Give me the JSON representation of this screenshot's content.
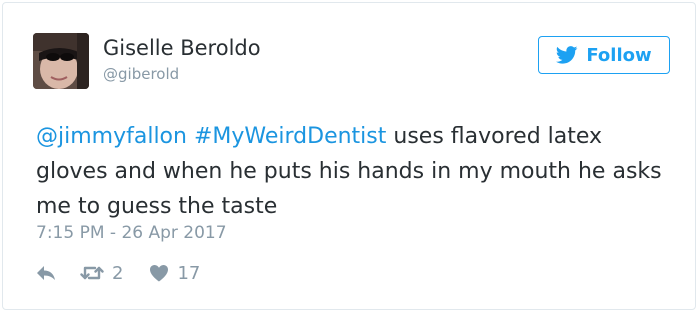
{
  "user": {
    "display_name": "Giselle Beroldo",
    "handle": "@giberold",
    "avatar_icon": "profile-photo"
  },
  "follow_button": {
    "label": "Follow",
    "icon": "twitter-bird-icon",
    "color": "#1da1f2"
  },
  "tweet": {
    "mention": "@jimmyfallon",
    "hashtag": "#MyWeirdDentist",
    "text": " uses flavored latex gloves and when he puts his hands in my mouth he asks me to guess the taste",
    "link_color": "#1b95e0"
  },
  "timestamp": "7:15 PM - 26 Apr 2017",
  "actions": {
    "reply_icon": "reply-icon",
    "retweet_icon": "retweet-icon",
    "retweet_count": "2",
    "like_icon": "heart-icon",
    "like_count": "17"
  }
}
